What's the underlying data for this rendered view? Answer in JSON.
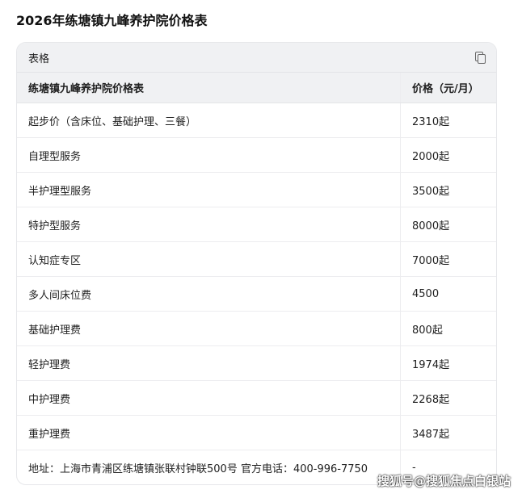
{
  "title": "2026年练塘镇九峰养护院价格表",
  "card": {
    "label": "表格",
    "copy_icon": "copy-icon"
  },
  "table": {
    "headers": [
      "练塘镇九峰养护院价格表",
      "价格（元/月）"
    ],
    "rows": [
      [
        "起步价（含床位、基础护理、三餐）",
        "2310起"
      ],
      [
        "自理型服务",
        "2000起"
      ],
      [
        "半护理型服务",
        "3500起"
      ],
      [
        "特护型服务",
        "8000起"
      ],
      [
        "认知症专区",
        "7000起"
      ],
      [
        "多人间床位费",
        "4500"
      ],
      [
        "基础护理费",
        "800起"
      ],
      [
        "轻护理费",
        "1974起"
      ],
      [
        "中护理费",
        "2268起"
      ],
      [
        "重护理费",
        "3487起"
      ],
      [
        "地址：上海市青浦区练塘镇张联村钟联500号 官方电话：400-996-7750",
        "-"
      ]
    ]
  },
  "watermark": "搜狐号@搜狐焦点白银站"
}
